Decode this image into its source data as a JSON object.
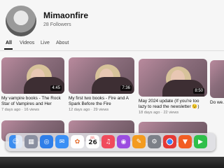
{
  "channel": {
    "name": "Mimaonfire",
    "followers": "28 Followers"
  },
  "tabs": [
    "All",
    "Videos",
    "Live",
    "About"
  ],
  "videos": [
    {
      "title": "My vampire books - The Rock Star of Vampires and Her Name is...",
      "meta": "7 days ago  ·  16 views",
      "duration": "4:45"
    },
    {
      "title": "My first two books - Fire and A Spark Before the Fire",
      "meta": "12 days ago  ·  29 views",
      "duration": "7:36"
    },
    {
      "title": "May 2024 update (If you're too lazy to read the newsletter 😉)",
      "meta": "18 days ago  ·  22 views",
      "duration": "8:50"
    },
    {
      "title": "Do we...",
      "meta": "",
      "duration": ""
    }
  ],
  "dock": {
    "calendar_month": "JUL",
    "calendar_day": "26",
    "icons": [
      "finder-icon",
      "launchpad-icon",
      "safari-icon",
      "mail-icon",
      "photos-icon",
      "calendar-icon",
      "music-icon",
      "podcasts-icon",
      "pages-icon",
      "settings-icon",
      "chrome-icon",
      "brave-icon",
      "facetime-icon"
    ]
  }
}
